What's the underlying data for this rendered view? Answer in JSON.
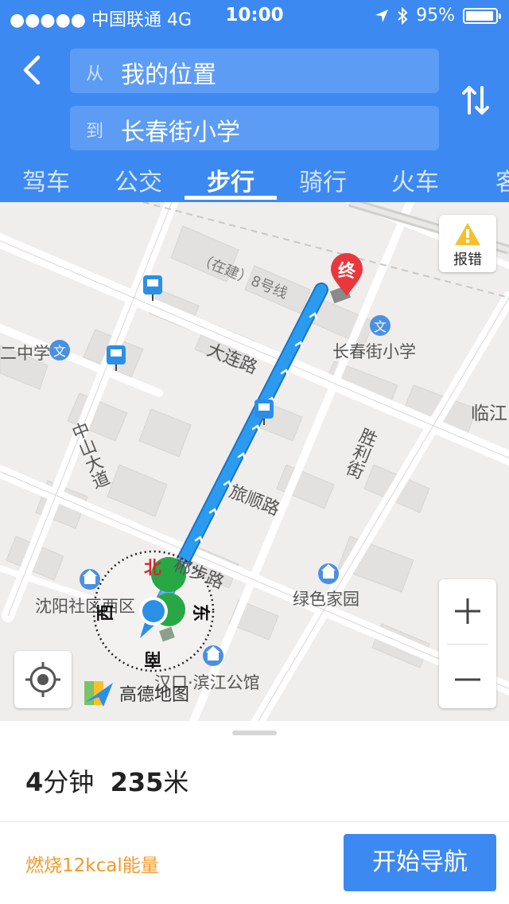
{
  "status_bar": {
    "signal": "●●●●● 中国联通 4G",
    "time": "10:00",
    "battery_text": "95%",
    "battery_level": 0.95
  },
  "route": {
    "from_tag": "从",
    "from_value": "我的位置",
    "to_tag": "到",
    "to_value": "长春街小学"
  },
  "tabs": [
    "驾车",
    "公交",
    "步行",
    "骑行",
    "火车",
    "客"
  ],
  "active_tab": 2,
  "map": {
    "labels": {
      "road_dalian": "大连路",
      "road_zhongshan": "中山大道",
      "road_lvshun": "旅顺路",
      "road_shengli": "胜利街",
      "road_chengbu": "郴步路",
      "metro_line": "（在建）8号线",
      "school_changchun": "长春街小学",
      "school_er": "二中学",
      "linjiang": "临江",
      "green_home": "绿色家园",
      "shenyang": "沈阳社区西区",
      "binjiang": "汉口·滨江公馆"
    },
    "end_marker": "终",
    "compass": {
      "north": "北",
      "east": "东",
      "south": "南",
      "west": "西"
    },
    "error_label": "报错",
    "logo_text": "高德地图"
  },
  "summary": {
    "minutes_num": "4",
    "minutes_unit": "分钟",
    "distance_num": "235",
    "distance_unit": "米",
    "calories": "燃烧12kcal能量",
    "start_label": "开始导航"
  },
  "colors": {
    "primary": "#3d89f2",
    "route": "#2b9bf0",
    "end_marker": "#e8383d",
    "calorie": "#f39a2b"
  }
}
